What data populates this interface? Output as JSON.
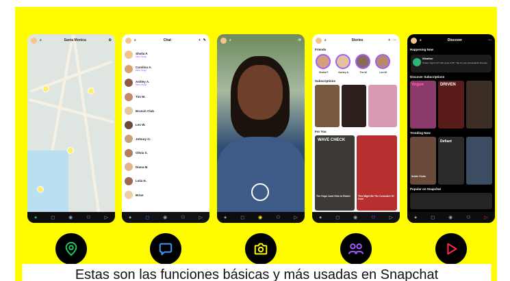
{
  "map_screen": {
    "city": "Santa Monica"
  },
  "chat_screen": {
    "title": "Chat",
    "contacts": [
      {
        "name": "Sheila F.",
        "status": "New Snap"
      },
      {
        "name": "Carolina A.",
        "status": "New Snap"
      },
      {
        "name": "Ashley A.",
        "status": "New Snap"
      },
      {
        "name": "Tim W.",
        "status": ""
      },
      {
        "name": "Brunch Club",
        "status": ""
      },
      {
        "name": "Leo W.",
        "status": ""
      },
      {
        "name": "Johnny O.",
        "status": ""
      },
      {
        "name": "Olivia S.",
        "status": ""
      },
      {
        "name": "Diana M.",
        "status": ""
      },
      {
        "name": "Leila D.",
        "status": ""
      },
      {
        "name": "Brian",
        "status": ""
      }
    ]
  },
  "stories_screen": {
    "title": "Stories",
    "friends_label": "Friends",
    "friends": [
      "Sheila F.",
      "Ashley A.",
      "Tim W.",
      "Leo W."
    ],
    "subscriptions_label": "Subscriptions",
    "for_you_label": "For You",
    "tile_titles": [
      "WAVE CHECK",
      "The Hope Land Gets in Reach",
      "This Might Be The Coronaire Of Cool"
    ]
  },
  "discover_screen": {
    "title": "Discover",
    "happening_now_label": "Happening Now",
    "weather_title": "Weather",
    "weather_text": "Today's high is 64° with a low of 55°. Tap for your personalized forecast.",
    "subscriptions_label": "Discover Subscriptions",
    "trending_label": "Trending Now",
    "popular_label": "Popular on Snapchat",
    "tile_titles": [
      "Vogue",
      "DRIVEN",
      "Inside Clubs",
      "Defiant"
    ]
  },
  "tabs": [
    {
      "name": "map",
      "icon": "map-pin-icon",
      "color": "#22c55e"
    },
    {
      "name": "chat",
      "icon": "chat-bubble-icon",
      "color": "#3b9cf6"
    },
    {
      "name": "camera",
      "icon": "camera-icon",
      "color": "#fffc00"
    },
    {
      "name": "stories",
      "icon": "friends-icon",
      "color": "#a05cff"
    },
    {
      "name": "spotlight",
      "icon": "play-icon",
      "color": "#ff2a4d"
    }
  ],
  "caption": "Estas son las funciones básicas y más usadas en Snapchat",
  "colors": {
    "snap_yellow": "#fffc00"
  }
}
